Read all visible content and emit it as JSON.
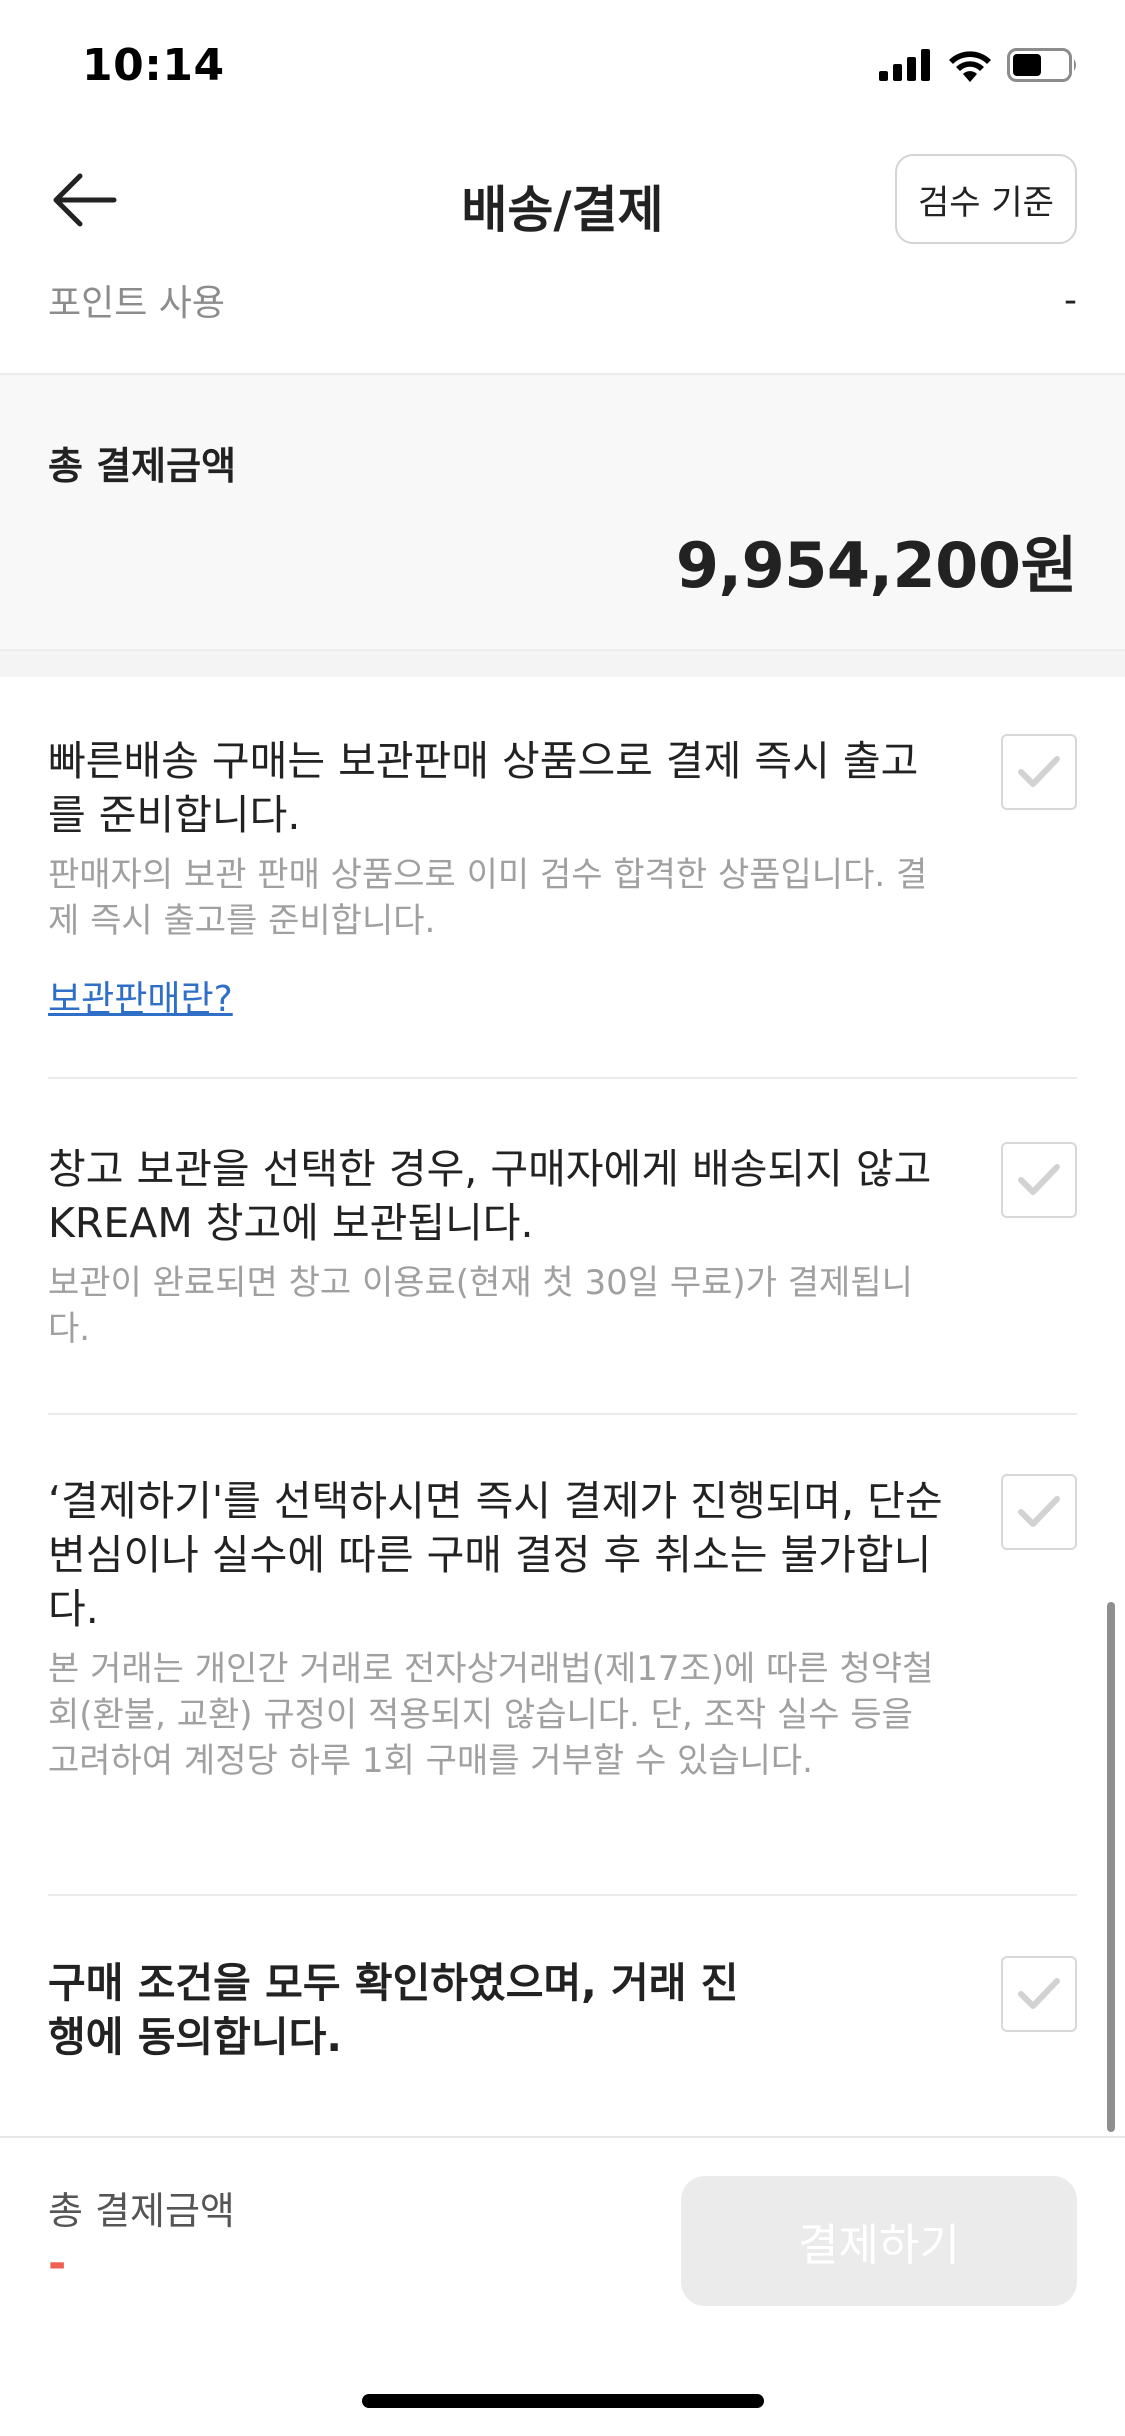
{
  "status_bar": {
    "time": "10:14"
  },
  "header": {
    "title": "배송/결제",
    "criteria_button": "검수 기준"
  },
  "point_row": {
    "label": "포인트 사용",
    "value": "-"
  },
  "total": {
    "label": "총 결제금액",
    "amount": "9,954,200원"
  },
  "agreements": [
    {
      "title": "빠른배송 구매는 보관판매 상품으로 결제 즉시 출고를 준비합니다.",
      "description": "판매자의 보관 판매 상품으로 이미 검수 합격한 상품입니다. 결제 즉시 출고를 준비합니다.",
      "link": "보관판매란?"
    },
    {
      "title": "창고 보관을 선택한 경우, 구매자에게 배송되지 않고 KREAM 창고에 보관됩니다.",
      "description": "보관이 완료되면 창고 이용료(현재 첫 30일 무료)가 결제됩니다."
    },
    {
      "title": "‘결제하기'를 선택하시면 즉시 결제가 진행되며, 단순 변심이나 실수에 따른 구매 결정 후 취소는 불가합니다.",
      "description": "본 거래는 개인간 거래로 전자상거래법(제17조)에 따른 청약철회(환불, 교환) 규정이 적용되지 않습니다. 단, 조작 실수 등을 고려하여 계정당 하루 1회 구매를 거부할 수 있습니다."
    },
    {
      "title": "구매 조건을 모두 확인하였으며, 거래 진행에 동의합니다."
    }
  ],
  "bottom_bar": {
    "label": "총 결제금액",
    "amount": "-",
    "pay_button": "결제하기"
  },
  "colors": {
    "accent_red": "#ef6253",
    "link_blue": "#2f6fc7",
    "disabled_button": "#ebebeb"
  },
  "icons": [
    "signal-icon",
    "wifi-icon",
    "battery-icon",
    "back-arrow-icon",
    "check-icon"
  ]
}
